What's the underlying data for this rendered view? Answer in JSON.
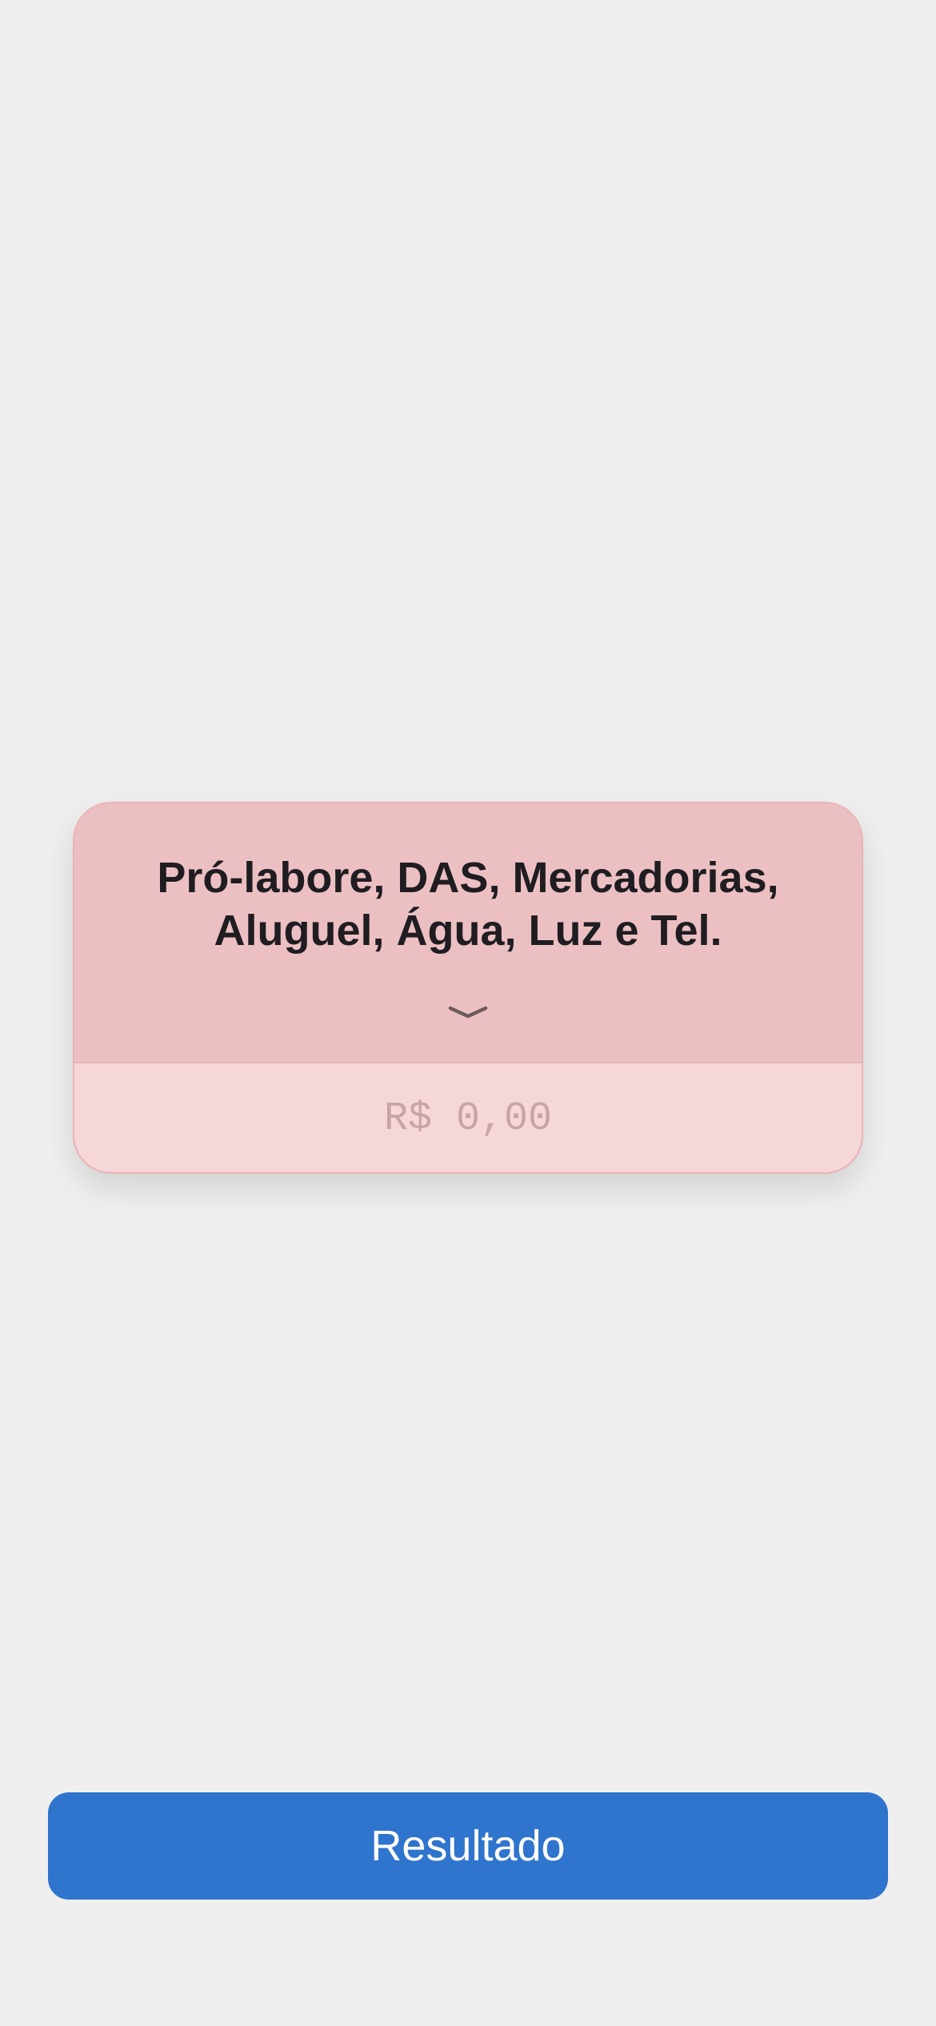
{
  "expense_card": {
    "title_line1": "Pró-labore, DAS, Mercadorias,",
    "title_line2": "Aluguel, Água, Luz e Tel.",
    "toggle_icon": "chevron-down-icon",
    "amount_value": "",
    "amount_placeholder": "R$ 0,00"
  },
  "actions": {
    "result_label": "Resultado"
  },
  "colors": {
    "background": "#efefef",
    "card_header": "#ecc0c2",
    "card_body": "#f6d7d9",
    "primary_button": "#2f74cd"
  }
}
